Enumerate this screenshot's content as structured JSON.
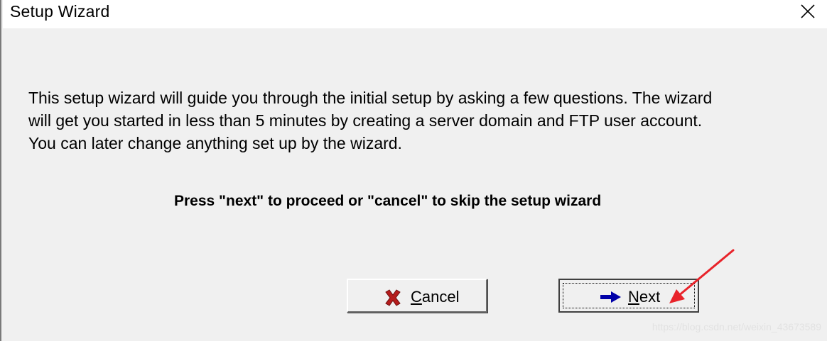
{
  "window": {
    "title": "Setup Wizard"
  },
  "content": {
    "description_lines": [
      "This setup wizard will guide you through the initial setup by asking a few questions. The wizard",
      "will get you started in less than 5 minutes by creating a server domain and FTP user account.",
      "You can later change anything set up by the wizard."
    ],
    "instruction": "Press \"next\" to proceed or \"cancel\" to skip the setup wizard"
  },
  "buttons": {
    "cancel": {
      "mnemonic": "C",
      "rest": "ancel",
      "icon": "red-x-icon"
    },
    "next": {
      "mnemonic": "N",
      "rest": "ext",
      "icon": "blue-right-arrow-icon"
    }
  },
  "annotation": {
    "icon": "red-pointer-arrow-icon",
    "color": "#e8232a"
  },
  "watermark": "https://blog.csdn.net/weixin_43673589"
}
